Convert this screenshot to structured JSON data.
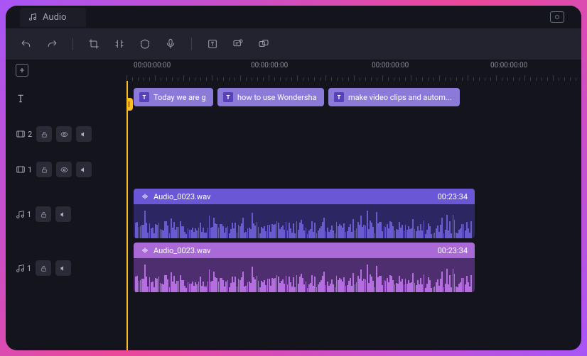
{
  "tab": {
    "label": "Audio"
  },
  "ruler": {
    "timecodes": [
      "00:00:00:00",
      "00:00:00:00",
      "00:00:00:00",
      "00:00:00:00"
    ]
  },
  "tracks": {
    "text": {
      "number": ""
    },
    "video2": {
      "number": "2"
    },
    "video1": {
      "number": "1"
    },
    "audio1": {
      "number": "1"
    },
    "audio2": {
      "number": "1"
    }
  },
  "textClips": [
    {
      "label": "Today we are g"
    },
    {
      "label": "how to use Wondersha"
    },
    {
      "label": "make video clips and autom..."
    }
  ],
  "audioClips": {
    "a1": {
      "name": "Audio_0023.wav",
      "duration": "00:23:34",
      "headerBg": "#6a57d6",
      "bodyBg": "#2c2663",
      "waveColor": "#6a5ad0"
    },
    "a2": {
      "name": "Audio_0023.wav",
      "duration": "00:23:34",
      "headerBg": "#a969d7",
      "bodyBg": "#4e2e6e",
      "waveColor": "#b46ee0"
    }
  },
  "textBadge": "T"
}
